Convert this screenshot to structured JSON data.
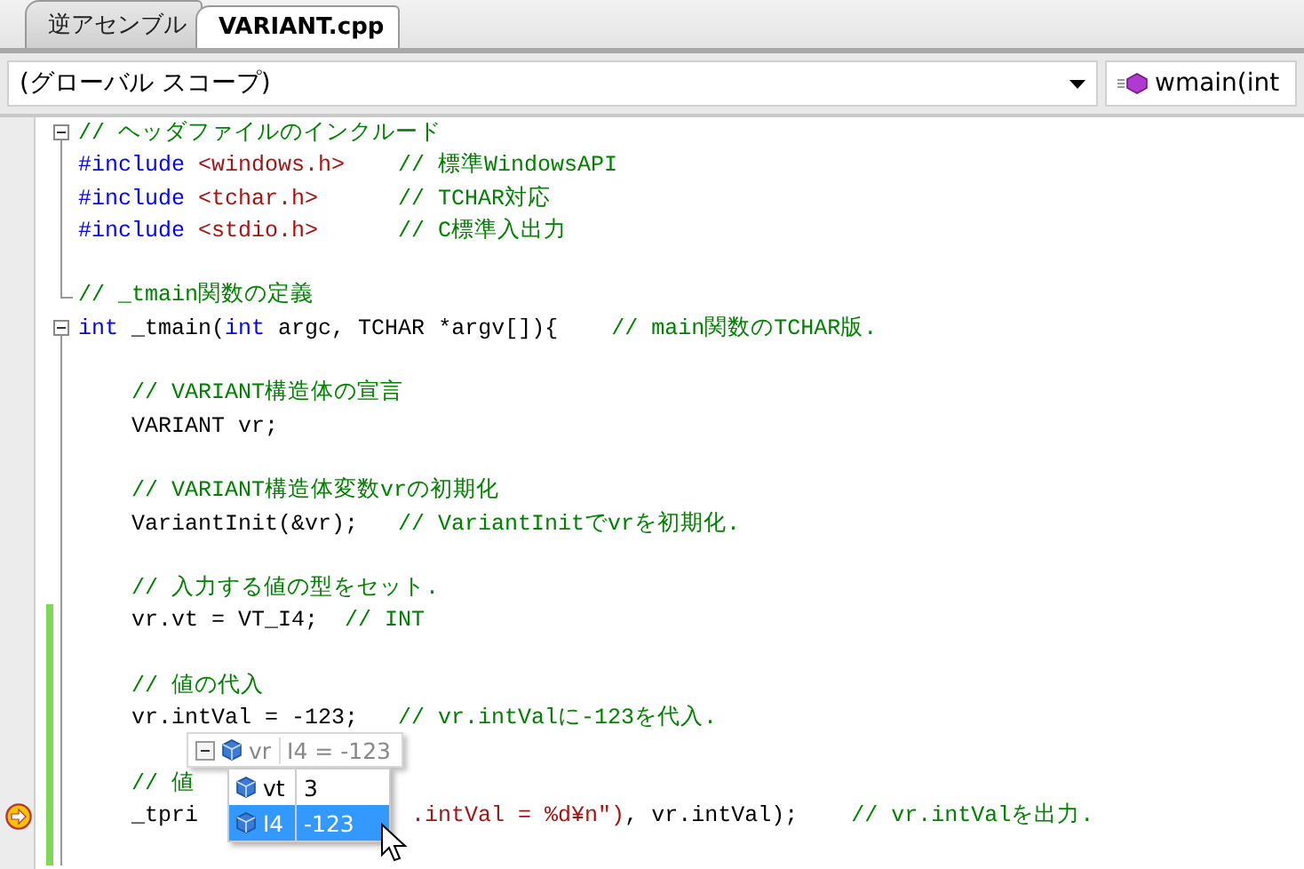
{
  "tabs": [
    {
      "label": "逆アセンブル",
      "selected": false
    },
    {
      "label": "VARIANT.cpp",
      "selected": true
    }
  ],
  "navigation_bar": {
    "scope": "(グローバル スコープ)",
    "member": "wmain(int"
  },
  "code_lines": [
    {
      "outline_start": true,
      "changed": false,
      "current": false,
      "tokens": [
        {
          "kind": "comment",
          "text": "// ヘッダファイルのインクルード"
        }
      ]
    },
    {
      "outline_start": false,
      "changed": false,
      "current": false,
      "tokens": [
        {
          "kind": "keyword",
          "text": "#include"
        },
        {
          "kind": "string",
          "text": " <windows.h>"
        },
        {
          "kind": "comment",
          "text": "    // 標準WindowsAPI"
        }
      ]
    },
    {
      "outline_start": false,
      "changed": false,
      "current": false,
      "tokens": [
        {
          "kind": "keyword",
          "text": "#include"
        },
        {
          "kind": "string",
          "text": " <tchar.h>"
        },
        {
          "kind": "comment",
          "text": "      // TCHAR対応"
        }
      ]
    },
    {
      "outline_start": false,
      "changed": false,
      "current": false,
      "tokens": [
        {
          "kind": "keyword",
          "text": "#include"
        },
        {
          "kind": "string",
          "text": " <stdio.h>"
        },
        {
          "kind": "comment",
          "text": "      // C標準入出力"
        }
      ]
    },
    {
      "outline_start": false,
      "changed": false,
      "current": false
    },
    {
      "outline_start": false,
      "changed": false,
      "current": false,
      "tokens": [
        {
          "kind": "comment",
          "text": "// _tmain関数の定義"
        }
      ]
    },
    {
      "outline_start": true,
      "changed": false,
      "current": false,
      "tokens": [
        {
          "kind": "keyword",
          "text": "int"
        },
        {
          "kind": "plain",
          "text": " _tmain("
        },
        {
          "kind": "keyword",
          "text": "int"
        },
        {
          "kind": "plain",
          "text": " argc, TCHAR *argv[]){"
        },
        {
          "kind": "comment",
          "text": "    // main関数のTCHAR版."
        }
      ]
    },
    {
      "outline_start": false,
      "changed": false,
      "current": false
    },
    {
      "outline_start": false,
      "changed": false,
      "current": false,
      "tokens": [
        {
          "kind": "comment",
          "text": "    // VARIANT構造体の宣言"
        }
      ]
    },
    {
      "outline_start": false,
      "changed": false,
      "current": false,
      "tokens": [
        {
          "kind": "plain",
          "text": "    VARIANT vr;"
        }
      ]
    },
    {
      "outline_start": false,
      "changed": false,
      "current": false
    },
    {
      "outline_start": false,
      "changed": false,
      "current": false,
      "tokens": [
        {
          "kind": "comment",
          "text": "    // VARIANT構造体変数vrの初期化"
        }
      ]
    },
    {
      "outline_start": false,
      "changed": false,
      "current": false,
      "tokens": [
        {
          "kind": "plain",
          "text": "    VariantInit(&vr);"
        },
        {
          "kind": "comment",
          "text": "   // VariantInitでvrを初期化."
        }
      ]
    },
    {
      "outline_start": false,
      "changed": false,
      "current": false
    },
    {
      "outline_start": false,
      "changed": false,
      "current": false,
      "tokens": [
        {
          "kind": "comment",
          "text": "    // 入力する値の型をセット."
        }
      ]
    },
    {
      "outline_start": false,
      "changed": true,
      "current": false,
      "tokens": [
        {
          "kind": "plain",
          "text": "    vr.vt = VT_I4;"
        },
        {
          "kind": "comment",
          "text": "  // INT"
        }
      ]
    },
    {
      "outline_start": false,
      "changed": true,
      "current": false
    },
    {
      "outline_start": false,
      "changed": true,
      "current": false,
      "tokens": [
        {
          "kind": "comment",
          "text": "    // 値の代入"
        }
      ]
    },
    {
      "outline_start": false,
      "changed": true,
      "current": false,
      "tokens": [
        {
          "kind": "plain",
          "text": "    vr.intVal = -123;"
        },
        {
          "kind": "comment",
          "text": "   // vr.intValに-123を代入."
        }
      ]
    },
    {
      "outline_start": false,
      "changed": true,
      "current": false
    },
    {
      "outline_start": false,
      "changed": true,
      "current": false,
      "tokens": [
        {
          "kind": "comment",
          "text": "    // 値"
        }
      ]
    },
    {
      "outline_start": false,
      "changed": true,
      "current": true,
      "tokens": [
        {
          "kind": "plain",
          "text": "    _tpri"
        },
        {
          "kind": "string",
          "text": ".intVal = %d¥n\")",
          "after_datatip": true
        },
        {
          "kind": "plain",
          "text": ", vr.intVal);"
        },
        {
          "kind": "comment",
          "text": "    // vr.intValを出力."
        }
      ]
    },
    {
      "outline_start": false,
      "changed": true,
      "current": false
    }
  ],
  "datatip": {
    "expanded": true,
    "name": "vr",
    "value": "I4 = -123",
    "members": [
      {
        "name": "vt",
        "value": "3",
        "selected": false
      },
      {
        "name": "I4",
        "value": "-123",
        "selected": true
      }
    ]
  }
}
